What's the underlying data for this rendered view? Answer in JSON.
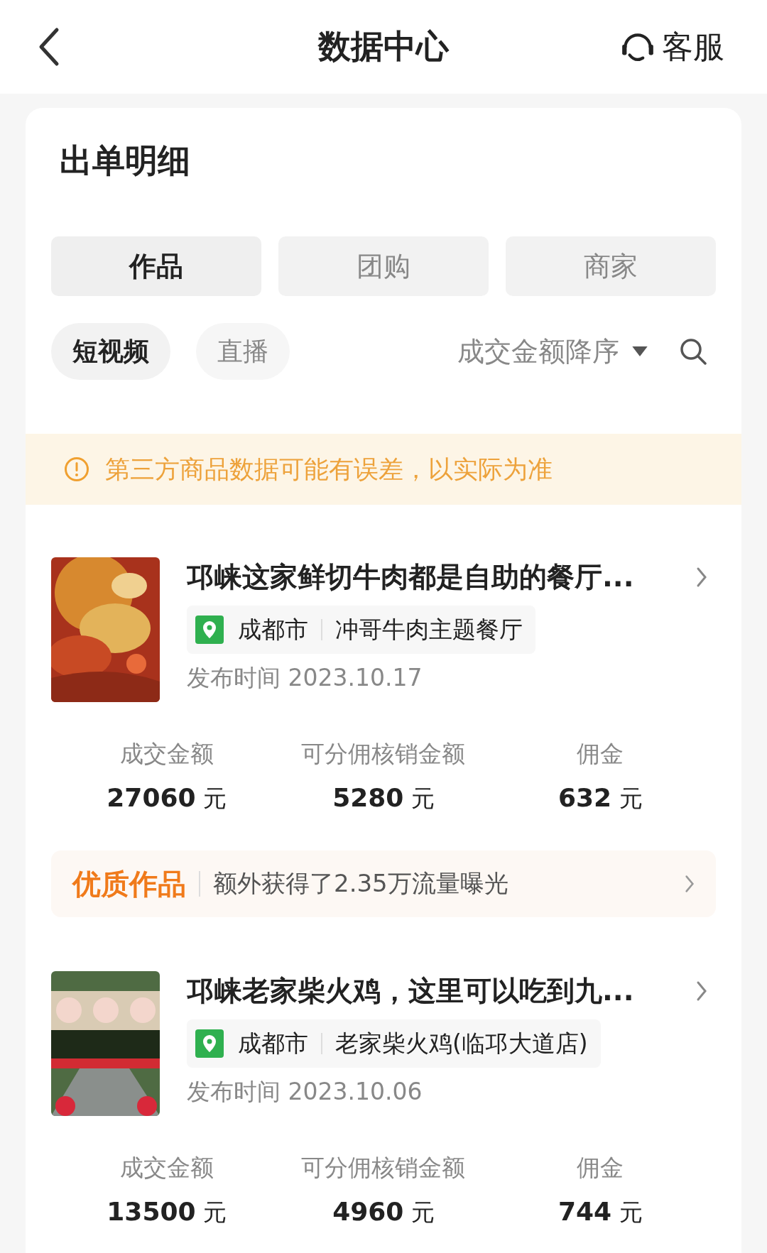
{
  "header": {
    "title": "数据中心",
    "service_label": "客服"
  },
  "section_title": "出单明细",
  "tabs": [
    {
      "label": "作品",
      "selected": true
    },
    {
      "label": "团购",
      "selected": false
    },
    {
      "label": "商家",
      "selected": false
    }
  ],
  "chips": [
    {
      "label": "短视频",
      "selected": true
    },
    {
      "label": "直播",
      "selected": false
    }
  ],
  "sort": {
    "label": "成交金额降序"
  },
  "notice": "第三方商品数据可能有误差，以实际为准",
  "items": [
    {
      "title": "邛崃这家鲜切牛肉都是自助的餐厅...",
      "city": "成都市",
      "store": "冲哥牛肉主题餐厅",
      "date": "发布时间 2023.10.17",
      "stats": [
        {
          "label": "成交金额",
          "value": "**27060** 元"
        },
        {
          "label": "可分佣核销金额",
          "value": "**5280** 元"
        },
        {
          "label": "佣金",
          "value": "**632** 元"
        }
      ],
      "quality": {
        "badge": "优质作品",
        "text": "额外获得了2.35万流量曝光"
      }
    },
    {
      "title": "邛崃老家柴火鸡，这里可以吃到九...",
      "city": "成都市",
      "store": "老家柴火鸡(临邛大道店)",
      "date": "发布时间 2023.10.06",
      "stats": [
        {
          "label": "成交金额",
          "value": "**13500** 元"
        },
        {
          "label": "可分佣核销金额",
          "value": "**4960** 元"
        },
        {
          "label": "佣金",
          "value": "**744** 元"
        }
      ]
    }
  ]
}
